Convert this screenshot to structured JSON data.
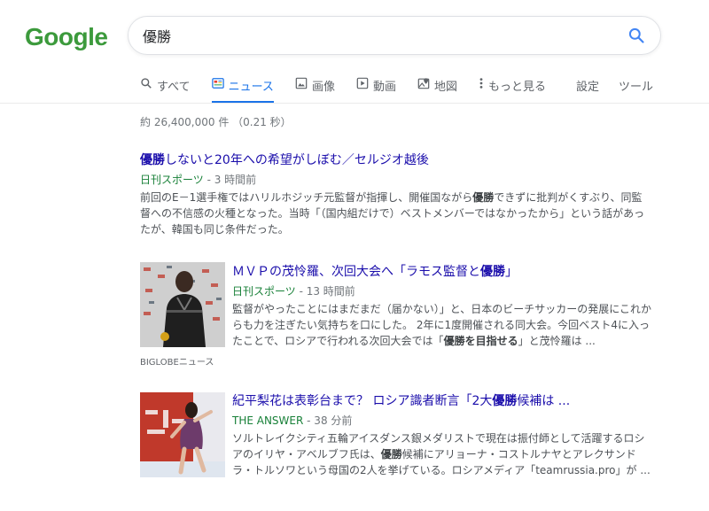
{
  "logo": "Google",
  "search": {
    "query": "優勝"
  },
  "tabs": [
    {
      "label": "すべて",
      "icon": "search-icon"
    },
    {
      "label": "ニュース",
      "icon": "news-icon",
      "active": true
    },
    {
      "label": "画像",
      "icon": "image-icon"
    },
    {
      "label": "動画",
      "icon": "video-icon"
    },
    {
      "label": "地図",
      "icon": "map-icon"
    },
    {
      "label": "もっと見る",
      "icon": "more-vert-icon"
    }
  ],
  "tools": {
    "settings": "設定",
    "tools": "ツール"
  },
  "stats": "約 26,400,000 件 （0.21 秒）",
  "results": [
    {
      "title_bold": "優勝",
      "title_rest": "しないと20年への希望がしぼむ／セルジオ越後",
      "source": "日刊スポーツ",
      "time": " - 3 時間前",
      "snippet_a": "前回のE－1選手権ではハリルホジッチ元監督が指揮し、開催国ながら",
      "snippet_bold": "優勝",
      "snippet_b": "できずに批判がくすぶり、同監督への不信感の火種となった。当時「（国内組だけで）ベストメンバーではなかったから」という話があったが、韓国も同じ条件だった。"
    },
    {
      "title_a": "ＭＶＰの茂怜羅、次回大会へ「ラモス監督と",
      "title_bold": "優勝",
      "title_b": "」",
      "source": "日刊スポーツ",
      "time": " - 13 時間前",
      "snippet_a": "監督がやったことにはまだまだ（届かない）」と、日本のビーチサッカーの発展にこれからも力を注ぎたい気持ちを口にした。 2年に1度開催される同大会。今回ベスト4に入ったことで、ロシアで行われる次回大会では「",
      "snippet_bold": "優勝を目指せる",
      "snippet_b": "」と茂怜羅は ...",
      "thumb_caption": "BIGLOBEニュース"
    },
    {
      "title_a": "紀平梨花は表彰台まで？ ロシア識者断言「2大",
      "title_bold": "優勝",
      "title_b": "候補は ...",
      "source": "THE ANSWER",
      "time": " - 38 分前",
      "snippet_a": "ソルトレイクシティ五輪アイスダンス銀メダリストで現在は振付師として活躍するロシアのイリヤ・アベルブフ氏は、",
      "snippet_bold": "優勝",
      "snippet_b": "候補にアリョーナ・コストルナヤとアレクサンドラ・トルソワという母国の2人を挙げている。ロシアメディア「teamrussia.pro」が ..."
    }
  ],
  "colors": {
    "link": "#1a0dab",
    "source": "#188038",
    "accent": "#1a73e8"
  }
}
